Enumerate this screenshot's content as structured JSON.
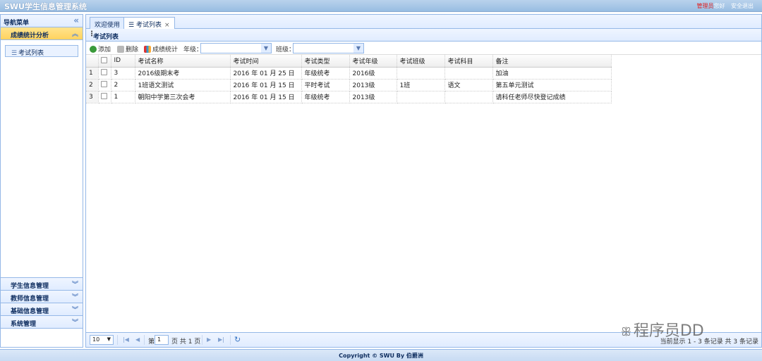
{
  "app": {
    "title": "SWU学生信息管理系统",
    "user_label": "管理员",
    "greeting": "您好",
    "logout": "安全退出"
  },
  "sidebar": {
    "title": "导航菜单",
    "active_group": "成绩统计分析",
    "active_items": [
      {
        "label": "考试列表"
      }
    ],
    "groups": [
      {
        "label": "学生信息管理"
      },
      {
        "label": "教师信息管理"
      },
      {
        "label": "基础信息管理"
      },
      {
        "label": "系统管理"
      }
    ]
  },
  "tabs": [
    {
      "label": "欢迎使用"
    },
    {
      "label": "考试列表"
    }
  ],
  "panel": {
    "title": "考试列表"
  },
  "toolbar": {
    "add": "添加",
    "delete": "删除",
    "stats": "成绩统计",
    "grade_label": "年级：",
    "class_label": "班级：",
    "grade_value": "",
    "class_value": ""
  },
  "grid": {
    "columns": [
      "ID",
      "考试名称",
      "考试时间",
      "考试类型",
      "考试年级",
      "考试班级",
      "考试科目",
      "备注"
    ],
    "rows": [
      {
        "num": "1",
        "id": "3",
        "name": "2016级期末考",
        "time": "2016 年 01 月 25 日",
        "type": "年级统考",
        "grade": "2016级",
        "class": "",
        "subject": "",
        "note": "加油"
      },
      {
        "num": "2",
        "id": "2",
        "name": "1班语文测试",
        "time": "2016 年 01 月 15 日",
        "type": "平时考试",
        "grade": "2013级",
        "class": "1班",
        "subject": "语文",
        "note": "第五单元测试"
      },
      {
        "num": "3",
        "id": "1",
        "name": "朝阳中学第三次会考",
        "time": "2016 年 01 月 15 日",
        "type": "年级统考",
        "grade": "2013级",
        "class": "",
        "subject": "",
        "note": "请科任老师尽快登记成绩"
      }
    ]
  },
  "pager": {
    "page_size": "10",
    "page_prefix": "第",
    "current_page": "1",
    "page_suffix": "页 共 1 页",
    "summary": "当前显示 1 - 3 条记录 共 3 条记录"
  },
  "footer": {
    "copyright": "Copyright © SWU By 伯爵洲"
  },
  "watermark": {
    "text": "程序员DD"
  }
}
